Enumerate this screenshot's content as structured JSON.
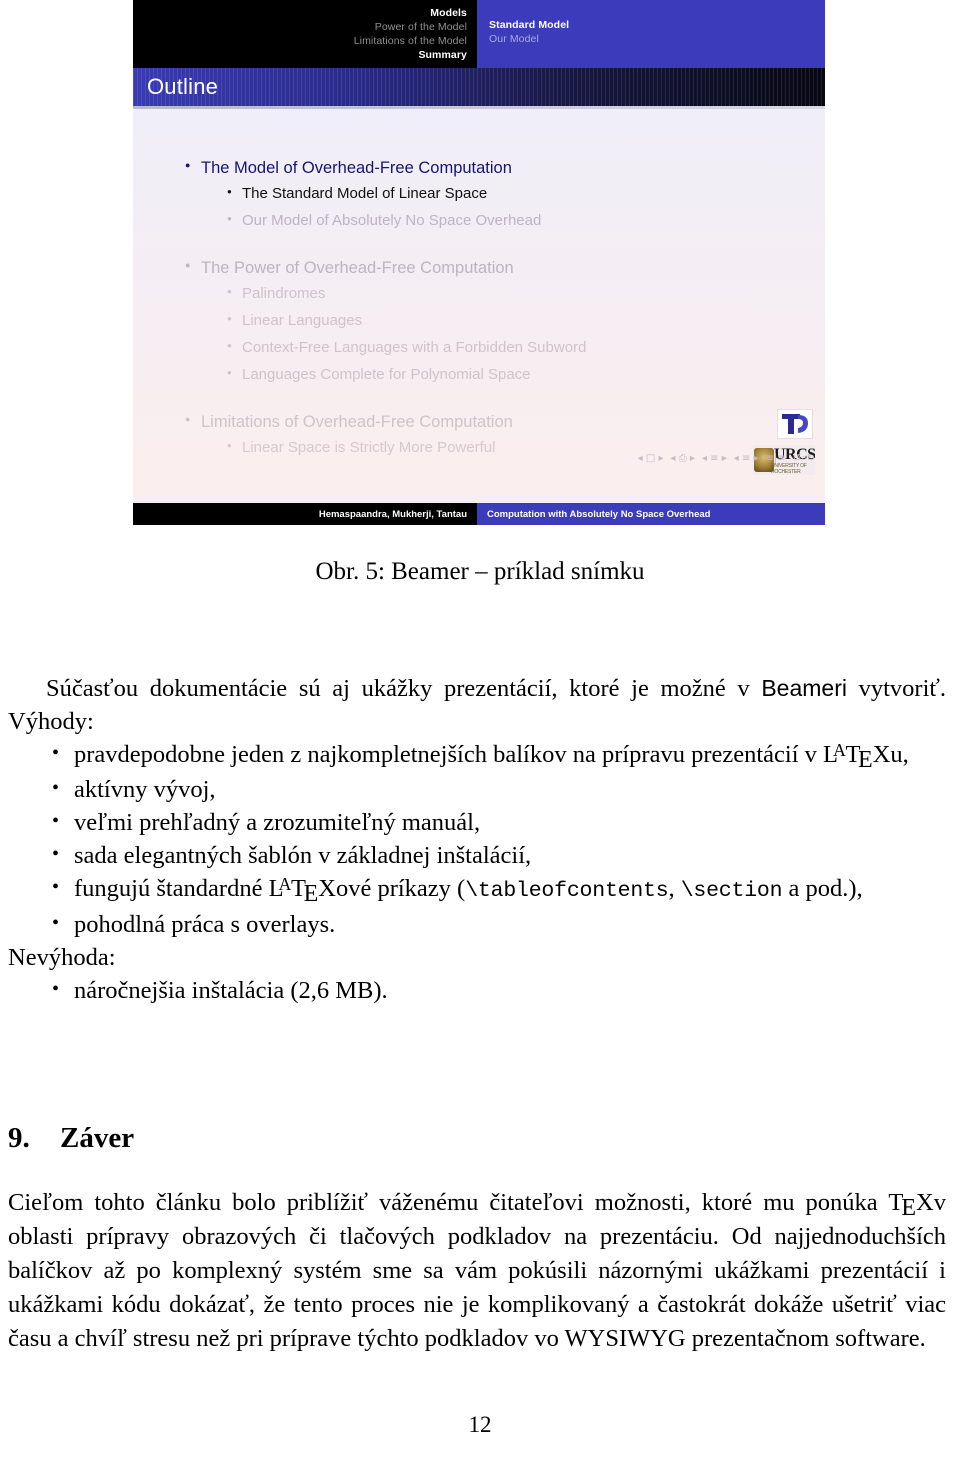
{
  "slide": {
    "nav_left": [
      {
        "label": "Models",
        "state": "active"
      },
      {
        "label": "Power of the Model",
        "state": "dim"
      },
      {
        "label": "Limitations of the Model",
        "state": "dim"
      },
      {
        "label": "Summary",
        "state": "active"
      }
    ],
    "nav_right": [
      {
        "label": "Standard Model",
        "state": "active"
      },
      {
        "label": "Our Model",
        "state": "dim"
      }
    ],
    "title": "Outline",
    "outline": [
      {
        "level": 1,
        "label": "The Model of Overhead-Free Computation",
        "shade": "strong"
      },
      {
        "level": 2,
        "label": "The Standard Model of Linear Space",
        "shade": "black"
      },
      {
        "level": 2,
        "label": "Our Model of Absolutely No Space Overhead",
        "shade": "dim1"
      },
      {
        "level": 1,
        "label": "The Power of Overhead-Free Computation",
        "shade": "dim1",
        "gap": true
      },
      {
        "level": 2,
        "label": "Palindromes",
        "shade": "dim2"
      },
      {
        "level": 2,
        "label": "Linear Languages",
        "shade": "dim2"
      },
      {
        "level": 2,
        "label": "Context-Free Languages with a Forbidden Subword",
        "shade": "dim2"
      },
      {
        "level": 2,
        "label": "Languages Complete for Polynomial Space",
        "shade": "dim2"
      },
      {
        "level": 1,
        "label": "Limitations of Overhead-Free Computation",
        "shade": "dim2",
        "gap": true
      },
      {
        "level": 2,
        "label": "Linear Space is Strictly More Powerful",
        "shade": "dim3"
      }
    ],
    "logos": {
      "tu_logo": "tu-darmstadt-logo",
      "urcs_text": "URCS",
      "urcs_sub": "UNIVERSITY OF ROCHESTER"
    },
    "nav_symbols": [
      "◂ □ ▸",
      "◂ ⎙ ▸",
      "◂ ≡ ▸",
      "◂ ≡ ▸",
      "≡|≡",
      "↺⌕↻"
    ],
    "footer_left": "Hemaspaandra, Mukherji, Tantau",
    "footer_right": "Computation with Absolutely No Space Overhead"
  },
  "caption": "Obr. 5: Beamer – príklad snímku",
  "body": {
    "intro": "Súčasťou dokumentácie sú aj ukážky prezentácií, ktoré je možné v ",
    "intro_sans": "Beameri",
    "intro_cont": " vytvoriť. Výhody:",
    "bullet1_a": "pravdepodobne jeden z najkompletnejších balíkov na prípravu prezentácií v ",
    "bullet1_b": "u,",
    "bullet2": "aktívny vývoj,",
    "bullet3": "veľmi prehľadný a zrozumiteľný manuál,",
    "bullet4": "sada elegantných šablón v základnej inštalácií,",
    "bullet5_a": "fungujú štandardné ",
    "bullet5_b": "ové príkazy (",
    "bullet5_code1": "\\tableofcontents",
    "bullet5_mid": ", ",
    "bullet5_code2": "\\section",
    "bullet5_c": " a pod.),",
    "bullet6": "pohodlná práca s overlays.",
    "nevyhoda_label": "Nevýhoda:",
    "bullet7": "náročnejšia inštalácia (2,6 MB)."
  },
  "section": {
    "number": "9.",
    "title": "Záver"
  },
  "closing": {
    "part1": "Cieľom tohto článku bolo priblížiť váženému čitateľovi možnosti, ktoré mu ponúka ",
    "part2": "v oblasti prípravy obrazových či tlačových podkladov na prezentáciu. Od najjednoduchších balíčkov až po komplexný systém sme sa vám pokúsili názornými ukážkami prezentácií i ukážkami kódu dokázať, že tento proces nie je komplikovaný a častokrát dokáže ušetriť viac času a chvíľ stresu než pri príprave týchto podkladov vo WYSIWYG prezentačnom software."
  },
  "page_number": "12",
  "colors": {
    "slide_nav_blue": "#3b3bbb",
    "slide_nav_black": "#000000",
    "title_active_blue": "#151575",
    "slide_bg_top": "#f0eef8",
    "slide_bg_bottom": "#fbeeee"
  }
}
